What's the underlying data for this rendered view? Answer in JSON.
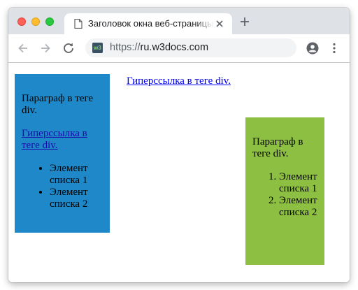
{
  "browser": {
    "tab_title": "Заголовок окна веб-страницы",
    "url_scheme": "https://",
    "url_host": "ru.w3docs.com",
    "site_icon_text": "w3"
  },
  "page": {
    "box1": {
      "paragraph": "Параграф в теге div.",
      "link": "Гиперссылка в теге div.",
      "list": [
        "Элемент списка 1",
        "Элемент списка 2"
      ]
    },
    "middle_link": "Гиперссылка в теге div.",
    "box2": {
      "paragraph": "Параграф в теге div.",
      "list": [
        "Элемент списка 1",
        "Элемент списка 2"
      ]
    }
  },
  "icons": {
    "tab": "document-icon",
    "tab_close": "close-icon",
    "new_tab": "plus-icon",
    "back": "arrow-left-icon",
    "forward": "arrow-right-icon",
    "reload": "reload-icon",
    "profile": "account-icon",
    "menu": "kebab-menu-icon"
  },
  "colors": {
    "box1_bg": "#1e88c8",
    "box2_bg": "#8dc042",
    "link": "#0000ee"
  }
}
